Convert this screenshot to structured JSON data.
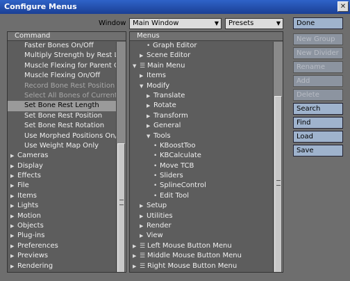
{
  "title": "Configure Menus",
  "window_label": "Window",
  "window_select": "Main Window",
  "presets_select": "Presets",
  "left": {
    "header": "Command",
    "items": [
      {
        "label": "Faster Bones On/Off",
        "type": "cmd"
      },
      {
        "label": "Multiply Strength by Rest Le...",
        "type": "cmd"
      },
      {
        "label": "Muscle Flexing for Parent O...",
        "type": "cmd"
      },
      {
        "label": "Muscle Flexing On/Off",
        "type": "cmd"
      },
      {
        "label": "Record Bone Rest Position",
        "type": "cmd",
        "disabled": true
      },
      {
        "label": "Select All Bones of Current ...",
        "type": "cmd",
        "disabled": true
      },
      {
        "label": "Set Bone Rest Length",
        "type": "cmd",
        "selected": true
      },
      {
        "label": "Set Bone Rest Position",
        "type": "cmd"
      },
      {
        "label": "Set Bone Rest Rotation",
        "type": "cmd"
      },
      {
        "label": "Use Morphed Positions On/...",
        "type": "cmd"
      },
      {
        "label": "Use Weight Map Only",
        "type": "cmd"
      },
      {
        "label": "Cameras",
        "type": "group"
      },
      {
        "label": "Display",
        "type": "group"
      },
      {
        "label": "Effects",
        "type": "group"
      },
      {
        "label": "File",
        "type": "group"
      },
      {
        "label": "Items",
        "type": "group"
      },
      {
        "label": "Lights",
        "type": "group"
      },
      {
        "label": "Motion",
        "type": "group"
      },
      {
        "label": "Objects",
        "type": "group"
      },
      {
        "label": "Plug-ins",
        "type": "group"
      },
      {
        "label": "Preferences",
        "type": "group"
      },
      {
        "label": "Previews",
        "type": "group"
      },
      {
        "label": "Rendering",
        "type": "group"
      }
    ]
  },
  "right": {
    "header": "Menus",
    "items": [
      {
        "label": "Graph Editor",
        "indent": 2,
        "mark": "dot"
      },
      {
        "label": "Scene Editor",
        "indent": 1,
        "mark": "tri-r"
      },
      {
        "label": "Main Menu",
        "indent": 0,
        "mark": "tri-d-menu"
      },
      {
        "label": "Items",
        "indent": 1,
        "mark": "tri-r"
      },
      {
        "label": "Modify",
        "indent": 1,
        "mark": "tri-d"
      },
      {
        "label": "Translate",
        "indent": 2,
        "mark": "tri-r"
      },
      {
        "label": "Rotate",
        "indent": 2,
        "mark": "tri-r"
      },
      {
        "label": "Transform",
        "indent": 2,
        "mark": "tri-r"
      },
      {
        "label": "General",
        "indent": 2,
        "mark": "tri-r"
      },
      {
        "label": "Tools",
        "indent": 2,
        "mark": "tri-d"
      },
      {
        "label": "KBoostToo",
        "indent": 3,
        "mark": "dot"
      },
      {
        "label": "KBCalculate",
        "indent": 3,
        "mark": "dot"
      },
      {
        "label": "Move TCB",
        "indent": 3,
        "mark": "dot"
      },
      {
        "label": "Sliders",
        "indent": 3,
        "mark": "dot"
      },
      {
        "label": "SplineControl",
        "indent": 3,
        "mark": "dot"
      },
      {
        "label": "Edit Tool",
        "indent": 3,
        "mark": "dot"
      },
      {
        "label": "Setup",
        "indent": 1,
        "mark": "tri-r"
      },
      {
        "label": "Utilities",
        "indent": 1,
        "mark": "tri-r"
      },
      {
        "label": "Render",
        "indent": 1,
        "mark": "tri-r"
      },
      {
        "label": "View",
        "indent": 1,
        "mark": "tri-r"
      },
      {
        "label": "Left Mouse Button Menu",
        "indent": 0,
        "mark": "tri-r-menu"
      },
      {
        "label": "Middle Mouse Button Menu",
        "indent": 0,
        "mark": "tri-r-menu"
      },
      {
        "label": "Right Mouse Button Menu",
        "indent": 0,
        "mark": "tri-r-menu"
      }
    ]
  },
  "buttons": [
    {
      "label": "Done",
      "disabled": false
    },
    {
      "label": "New Group",
      "disabled": true
    },
    {
      "label": "New Divider",
      "disabled": true
    },
    {
      "label": "Rename",
      "disabled": true
    },
    {
      "label": "Add",
      "disabled": true
    },
    {
      "label": "Delete",
      "disabled": true
    },
    {
      "label": "Search",
      "disabled": false
    },
    {
      "label": "Find",
      "disabled": false
    },
    {
      "label": "Load",
      "disabled": false
    },
    {
      "label": "Save",
      "disabled": false
    }
  ]
}
